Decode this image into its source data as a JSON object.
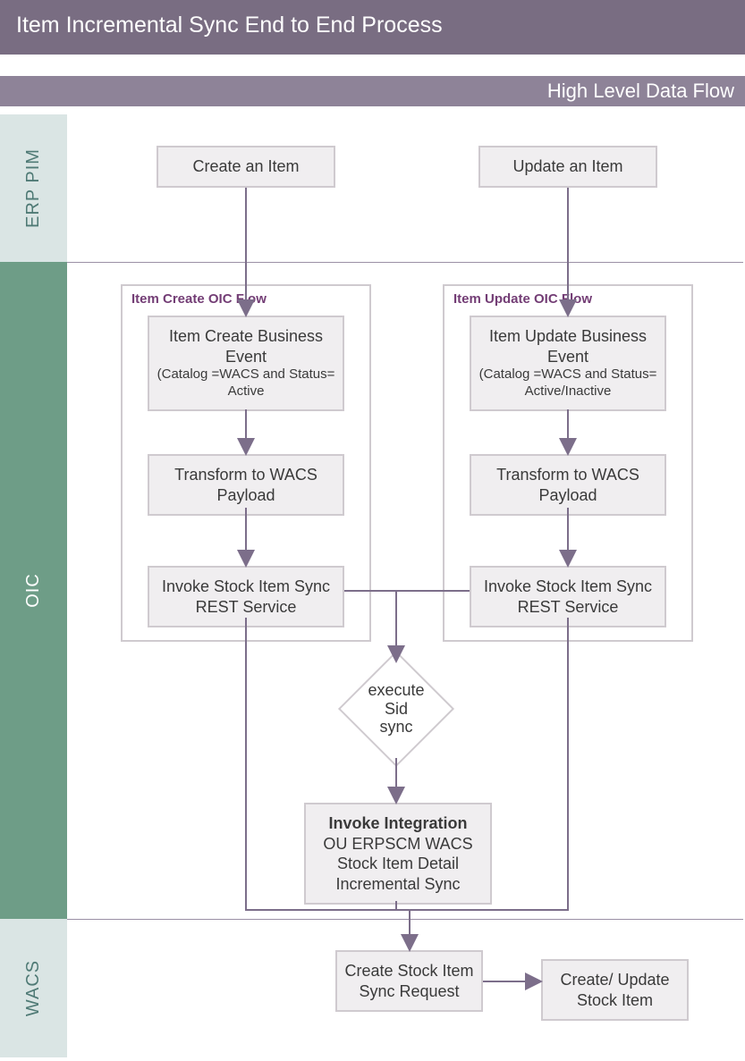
{
  "title": "Item Incremental Sync End to End Process",
  "subtitle": "High Level Data Flow",
  "lanes": {
    "erp": "ERP PIM",
    "oic": "OIC",
    "wacs": "WACS"
  },
  "erp": {
    "create": "Create an Item",
    "update": "Update an Item"
  },
  "groups": {
    "create": "Item Create OIC Flow",
    "update": "Item Update OIC Flow"
  },
  "create_flow": {
    "event": "Item Create Business Event",
    "event_sub": "(Catalog =WACS and Status= Active",
    "transform": "Transform to WACS Payload",
    "invoke": "Invoke  Stock Item Sync REST Service"
  },
  "update_flow": {
    "event": "Item Update Business Event",
    "event_sub": "(Catalog =WACS and Status= Active/Inactive",
    "transform": "Transform to WACS Payload",
    "invoke": "Invoke Stock Item Sync REST Service"
  },
  "decision": "execute\nSid\nsync",
  "integration": {
    "title": "Invoke Integration",
    "body": "OU ERPSCM WACS Stock Item Detail Incremental Sync"
  },
  "wacs_boxes": {
    "request": "Create Stock Item Sync Request",
    "result": "Create/ Update Stock Item"
  },
  "colors": {
    "arrow": "#7c6e8a"
  }
}
